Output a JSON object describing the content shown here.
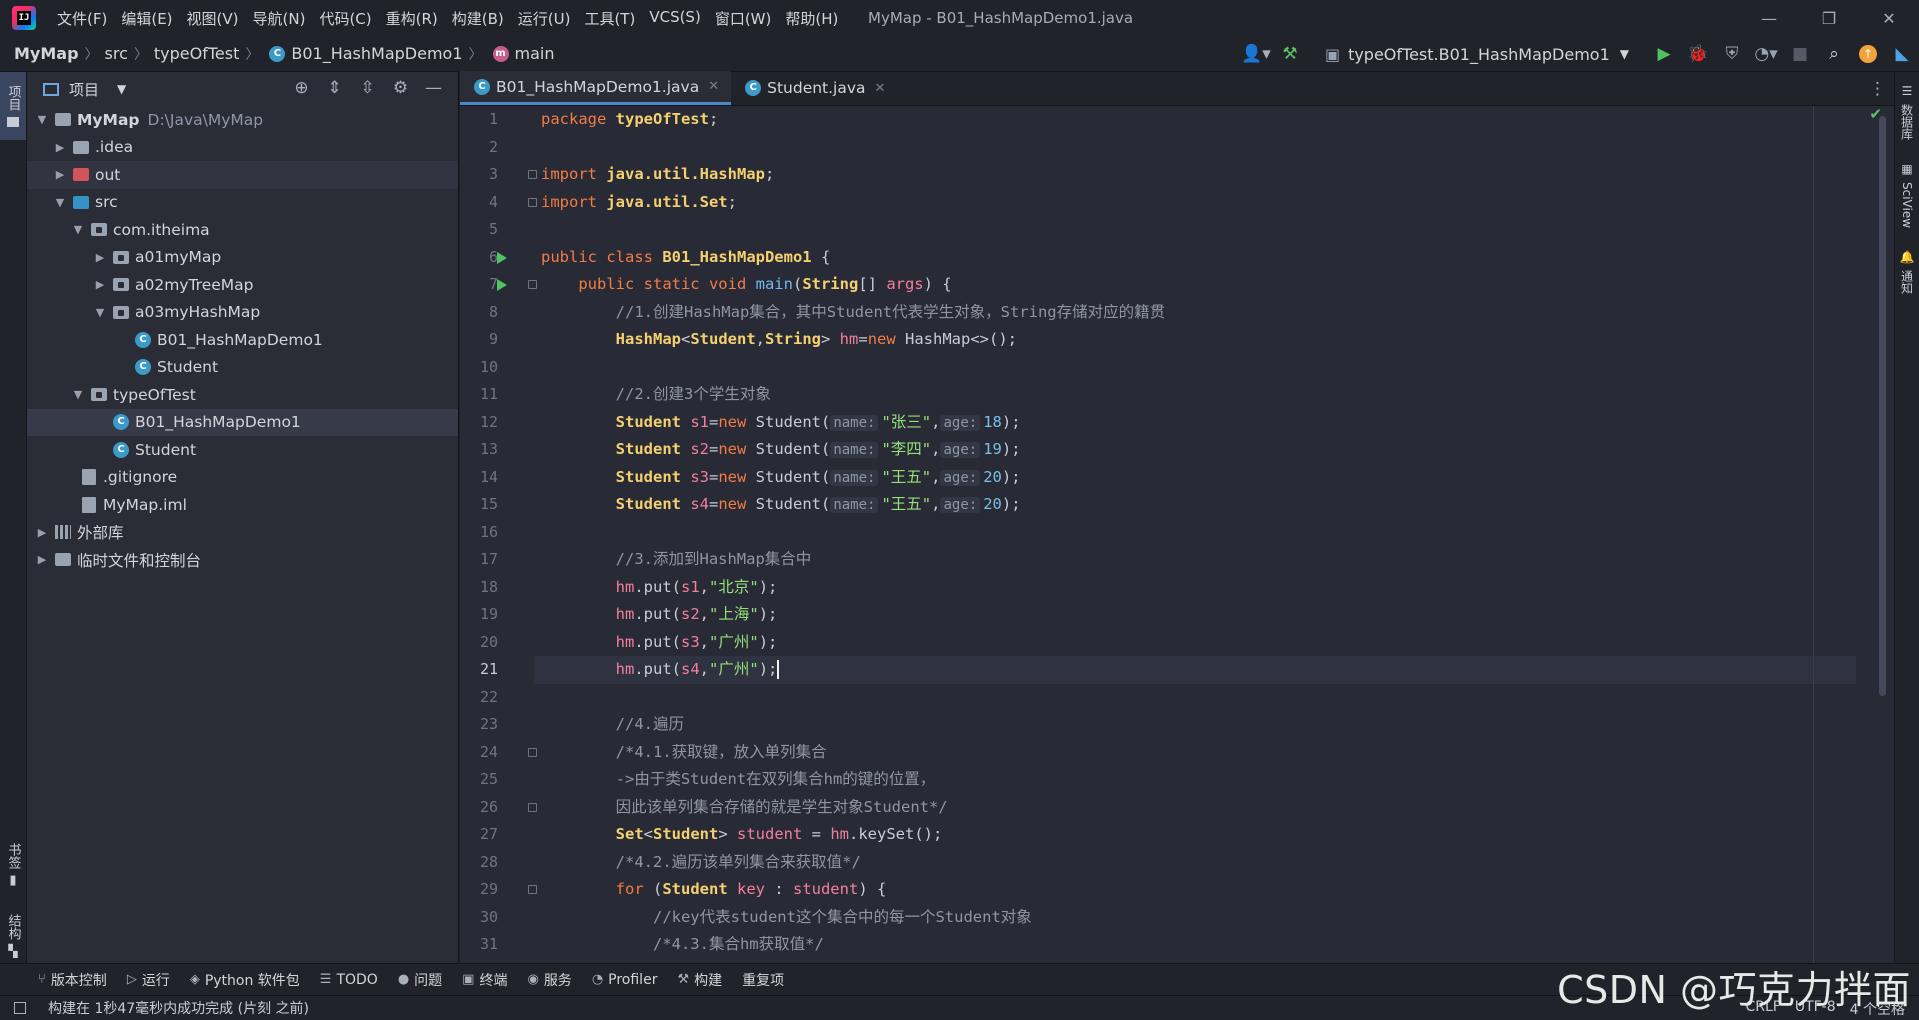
{
  "titlebar": {
    "menu": [
      "文件(F)",
      "编辑(E)",
      "视图(V)",
      "导航(N)",
      "代码(C)",
      "重构(R)",
      "构建(B)",
      "运行(U)",
      "工具(T)",
      "VCS(S)",
      "窗口(W)",
      "帮助(H)"
    ],
    "window_title": "MyMap - B01_HashMapDemo1.java"
  },
  "navbar": {
    "crumbs": [
      "MyMap",
      "src",
      "typeOfTest",
      "B01_HashMapDemo1",
      "main"
    ],
    "run_config": "typeOfTest.B01_HashMapDemo1"
  },
  "left_strip": {
    "project_tab": "项目",
    "bookmarks": "书签",
    "structure": "结构"
  },
  "right_strip": {
    "database": "数据库",
    "sciview": "SciView",
    "notifications": "通知"
  },
  "project_panel": {
    "title": "项目",
    "tree": [
      {
        "label": "MyMap",
        "path": "D:\\Java\\MyMap",
        "kind": "module"
      },
      {
        "label": ".idea",
        "kind": "folder"
      },
      {
        "label": "out",
        "kind": "folder-red"
      },
      {
        "label": "src",
        "kind": "folder-blue"
      },
      {
        "label": "com.itheima",
        "kind": "package"
      },
      {
        "label": "a01myMap",
        "kind": "package"
      },
      {
        "label": "a02myTreeMap",
        "kind": "package"
      },
      {
        "label": "a03myHashMap",
        "kind": "package"
      },
      {
        "label": "B01_HashMapDemo1",
        "kind": "class"
      },
      {
        "label": "Student",
        "kind": "class"
      },
      {
        "label": "typeOfTest",
        "kind": "package"
      },
      {
        "label": "B01_HashMapDemo1",
        "kind": "class"
      },
      {
        "label": "Student",
        "kind": "class"
      },
      {
        "label": ".gitignore",
        "kind": "file"
      },
      {
        "label": "MyMap.iml",
        "kind": "file"
      },
      {
        "label": "外部库",
        "kind": "library"
      },
      {
        "label": "临时文件和控制台",
        "kind": "scratch"
      }
    ]
  },
  "editor": {
    "tabs": [
      "B01_HashMapDemo1.java",
      "Student.java"
    ],
    "current_line": 21,
    "lines": [
      [
        [
          "kw",
          "package "
        ],
        [
          "cls",
          "typeOfTest"
        ],
        [
          "tx",
          ";"
        ]
      ],
      [],
      [
        [
          "kw",
          "import "
        ],
        [
          "cls",
          "java.util.HashMap"
        ],
        [
          "tx",
          ";"
        ]
      ],
      [
        [
          "kw",
          "import "
        ],
        [
          "cls",
          "java.util.Set"
        ],
        [
          "tx",
          ";"
        ]
      ],
      [],
      [
        [
          "kw",
          "public class "
        ],
        [
          "cls",
          "B01_HashMapDemo1"
        ],
        [
          "tx",
          " {"
        ]
      ],
      [
        [
          "tx",
          "    "
        ],
        [
          "kw",
          "public static void "
        ],
        [
          "fn",
          "main"
        ],
        [
          "tx",
          "("
        ],
        [
          "cls",
          "String"
        ],
        [
          "tx",
          "[] "
        ],
        [
          "var",
          "args"
        ],
        [
          "tx",
          ") {"
        ]
      ],
      [
        [
          "tx",
          "        "
        ],
        [
          "cm",
          "//1.创建HashMap集合，其中Student代表学生对象，String存储对应的籍贯"
        ]
      ],
      [
        [
          "tx",
          "        "
        ],
        [
          "cls",
          "HashMap"
        ],
        [
          "tx",
          "<"
        ],
        [
          "cls",
          "Student"
        ],
        [
          "tx",
          ","
        ],
        [
          "cls",
          "String"
        ],
        [
          "tx",
          "> "
        ],
        [
          "var",
          "hm"
        ],
        [
          "tx",
          "="
        ],
        [
          "kw",
          "new "
        ],
        [
          "tx",
          "HashMap<>();"
        ]
      ],
      [],
      [
        [
          "tx",
          "        "
        ],
        [
          "cm",
          "//2.创建3个学生对象"
        ]
      ],
      [
        [
          "tx",
          "        "
        ],
        [
          "cls",
          "Student "
        ],
        [
          "var",
          "s1"
        ],
        [
          "tx",
          "="
        ],
        [
          "kw",
          "new "
        ],
        [
          "tx",
          "Student("
        ],
        [
          "hint",
          "name:"
        ],
        [
          "str",
          "\"张三\""
        ],
        [
          "tx",
          ","
        ],
        [
          "hint",
          "age:"
        ],
        [
          "num",
          "18"
        ],
        [
          "tx",
          ");"
        ]
      ],
      [
        [
          "tx",
          "        "
        ],
        [
          "cls",
          "Student "
        ],
        [
          "var",
          "s2"
        ],
        [
          "tx",
          "="
        ],
        [
          "kw",
          "new "
        ],
        [
          "tx",
          "Student("
        ],
        [
          "hint",
          "name:"
        ],
        [
          "str",
          "\"李四\""
        ],
        [
          "tx",
          ","
        ],
        [
          "hint",
          "age:"
        ],
        [
          "num",
          "19"
        ],
        [
          "tx",
          ");"
        ]
      ],
      [
        [
          "tx",
          "        "
        ],
        [
          "cls",
          "Student "
        ],
        [
          "var",
          "s3"
        ],
        [
          "tx",
          "="
        ],
        [
          "kw",
          "new "
        ],
        [
          "tx",
          "Student("
        ],
        [
          "hint",
          "name:"
        ],
        [
          "str",
          "\"王五\""
        ],
        [
          "tx",
          ","
        ],
        [
          "hint",
          "age:"
        ],
        [
          "num",
          "20"
        ],
        [
          "tx",
          ");"
        ]
      ],
      [
        [
          "tx",
          "        "
        ],
        [
          "cls",
          "Student "
        ],
        [
          "var",
          "s4"
        ],
        [
          "tx",
          "="
        ],
        [
          "kw",
          "new "
        ],
        [
          "tx",
          "Student("
        ],
        [
          "hint",
          "name:"
        ],
        [
          "str",
          "\"王五\""
        ],
        [
          "tx",
          ","
        ],
        [
          "hint",
          "age:"
        ],
        [
          "num",
          "20"
        ],
        [
          "tx",
          ");"
        ]
      ],
      [],
      [
        [
          "tx",
          "        "
        ],
        [
          "cm",
          "//3.添加到HashMap集合中"
        ]
      ],
      [
        [
          "tx",
          "        "
        ],
        [
          "var",
          "hm"
        ],
        [
          "tx",
          ".put("
        ],
        [
          "var",
          "s1"
        ],
        [
          "tx",
          ","
        ],
        [
          "str",
          "\"北京\""
        ],
        [
          "tx",
          ");"
        ]
      ],
      [
        [
          "tx",
          "        "
        ],
        [
          "var",
          "hm"
        ],
        [
          "tx",
          ".put("
        ],
        [
          "var",
          "s2"
        ],
        [
          "tx",
          ","
        ],
        [
          "str",
          "\"上海\""
        ],
        [
          "tx",
          ");"
        ]
      ],
      [
        [
          "tx",
          "        "
        ],
        [
          "var",
          "hm"
        ],
        [
          "tx",
          ".put("
        ],
        [
          "var",
          "s3"
        ],
        [
          "tx",
          ","
        ],
        [
          "str",
          "\"广州\""
        ],
        [
          "tx",
          ");"
        ]
      ],
      [
        [
          "tx",
          "        "
        ],
        [
          "var",
          "hm"
        ],
        [
          "tx",
          ".put("
        ],
        [
          "var",
          "s4"
        ],
        [
          "tx",
          ","
        ],
        [
          "str",
          "\"广州\""
        ],
        [
          "tx",
          ");"
        ]
      ],
      [],
      [
        [
          "tx",
          "        "
        ],
        [
          "cm",
          "//4.遍历"
        ]
      ],
      [
        [
          "tx",
          "        "
        ],
        [
          "cm",
          "/*4.1.获取键，放入单列集合"
        ]
      ],
      [
        [
          "tx",
          "        "
        ],
        [
          "cm",
          "->由于类Student在双列集合hm的键的位置，"
        ]
      ],
      [
        [
          "tx",
          "        "
        ],
        [
          "cm",
          "因此该单列集合存储的就是学生对象Student*/"
        ]
      ],
      [
        [
          "tx",
          "        "
        ],
        [
          "cls",
          "Set"
        ],
        [
          "tx",
          "<"
        ],
        [
          "cls",
          "Student"
        ],
        [
          "tx",
          "> "
        ],
        [
          "var",
          "student"
        ],
        [
          "tx",
          " = "
        ],
        [
          "var",
          "hm"
        ],
        [
          "tx",
          ".keySet();"
        ]
      ],
      [
        [
          "tx",
          "        "
        ],
        [
          "cm",
          "/*4.2.遍历该单列集合来获取值*/"
        ]
      ],
      [
        [
          "tx",
          "        "
        ],
        [
          "kw",
          "for "
        ],
        [
          "tx",
          "("
        ],
        [
          "cls",
          "Student "
        ],
        [
          "var",
          "key"
        ],
        [
          "tx",
          " : "
        ],
        [
          "var",
          "student"
        ],
        [
          "tx",
          ") {"
        ]
      ],
      [
        [
          "tx",
          "            "
        ],
        [
          "cm",
          "//key代表student这个集合中的每一个Student对象"
        ]
      ],
      [
        [
          "tx",
          "            "
        ],
        [
          "cm",
          "/*4.3.集合hm获取值*/"
        ]
      ]
    ]
  },
  "bottom_tools": [
    "版本控制",
    "运行",
    "Python 软件包",
    "TODO",
    "问题",
    "终端",
    "服务",
    "Profiler",
    "构建",
    "重复项"
  ],
  "status": {
    "message": "构建在 1秒47毫秒内成功完成 (片刻 之前)",
    "line_sep": "CRLF",
    "encoding": "UTF-8",
    "indent": "4 个空格"
  },
  "watermark": "CSDN @巧克力拌面",
  "colors": {
    "keyword": "#f27c45",
    "class": "#f4d06f",
    "string": "#96e07a",
    "comment": "#8f96a3",
    "variable": "#f37f9c",
    "accent": "#4a88c7"
  }
}
